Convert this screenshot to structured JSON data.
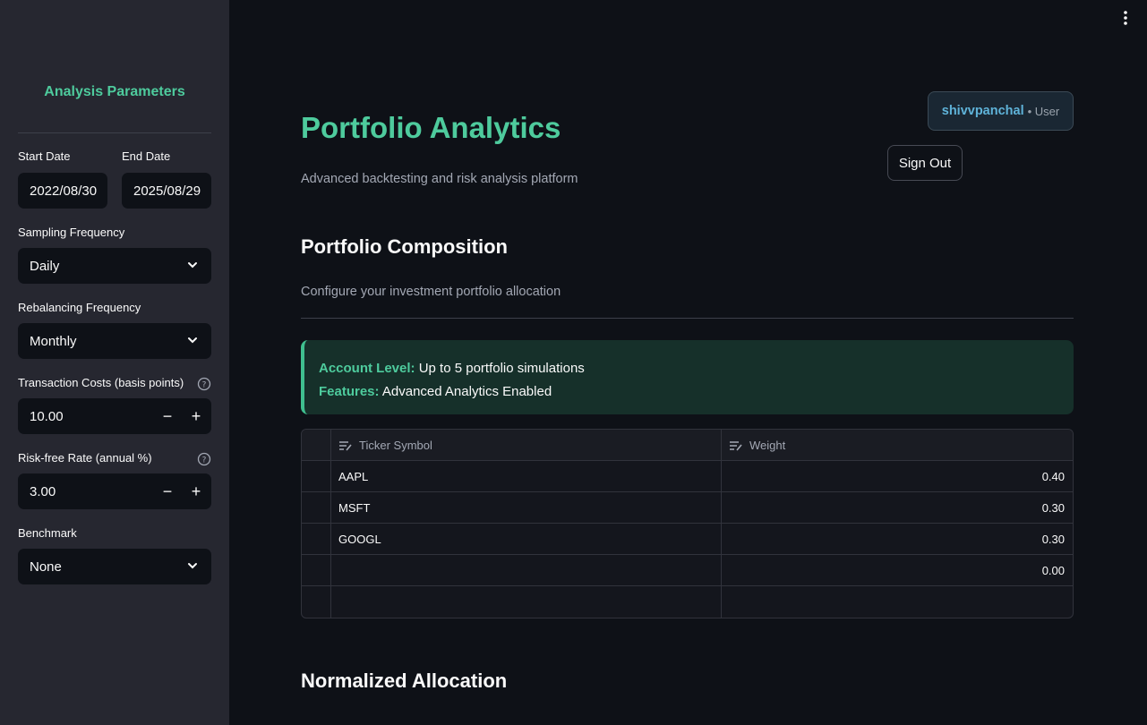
{
  "sidebar": {
    "title": "Analysis Parameters",
    "start_date": {
      "label": "Start Date",
      "value": "2022/08/30"
    },
    "end_date": {
      "label": "End Date",
      "value": "2025/08/29"
    },
    "sampling": {
      "label": "Sampling Frequency",
      "value": "Daily"
    },
    "rebalancing": {
      "label": "Rebalancing Frequency",
      "value": "Monthly"
    },
    "transaction_costs": {
      "label": "Transaction Costs (basis points)",
      "value": "10.00",
      "minus": "−",
      "plus": "+"
    },
    "risk_free": {
      "label": "Risk-free Rate (annual %)",
      "value": "3.00",
      "minus": "−",
      "plus": "+"
    },
    "benchmark": {
      "label": "Benchmark",
      "value": "None"
    }
  },
  "header": {
    "title": "Portfolio Analytics",
    "subtitle": "Advanced backtesting and risk analysis platform",
    "user_name": "shivvpanchal",
    "user_role": "• User",
    "sign_out": "Sign Out"
  },
  "composition": {
    "heading": "Portfolio Composition",
    "caption": "Configure your investment portfolio allocation",
    "alert": {
      "account_key": "Account Level:",
      "account_value": "Up to 5 portfolio simulations",
      "features_key": "Features:",
      "features_value": "Advanced Analytics Enabled"
    },
    "table": {
      "columns": [
        "Ticker Symbol",
        "Weight"
      ],
      "rows": [
        {
          "ticker": "AAPL",
          "weight": "0.40"
        },
        {
          "ticker": "MSFT",
          "weight": "0.30"
        },
        {
          "ticker": "GOOGL",
          "weight": "0.30"
        },
        {
          "ticker": "",
          "weight": "0.00"
        },
        {
          "ticker": "",
          "weight": ""
        }
      ]
    }
  },
  "normalized": {
    "heading": "Normalized Allocation"
  },
  "colors": {
    "accent": "#4ecb9d",
    "background": "#0e1117",
    "sidebar": "#262730",
    "user_accent": "#5fb3d9"
  },
  "icons": [
    "chevron-down-icon",
    "help-icon",
    "kebab-menu-icon",
    "edit-column-icon"
  ]
}
